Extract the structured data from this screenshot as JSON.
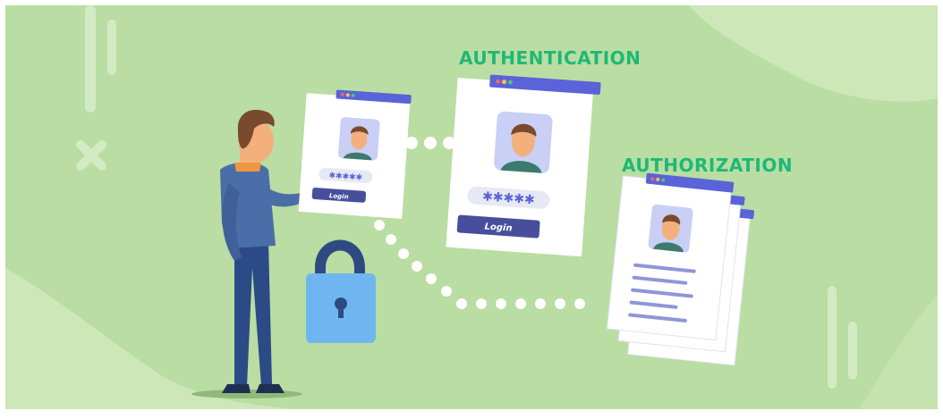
{
  "headings": {
    "authentication": "AUTHENTICATION",
    "authorization": "AUTHORIZATION"
  },
  "small_card": {
    "password_mask": "✱✱✱✱✱",
    "button_label": "Login"
  },
  "large_card": {
    "password_mask": "✱✱✱✱✱",
    "button_label": "Login"
  },
  "colors": {
    "background": "#b7dca0",
    "heading_green": "#1fb877",
    "window_bar": "#5a63d8",
    "button": "#474f9d",
    "lock_body": "#6fb6f0",
    "lock_shackle": "#2f4a82"
  }
}
